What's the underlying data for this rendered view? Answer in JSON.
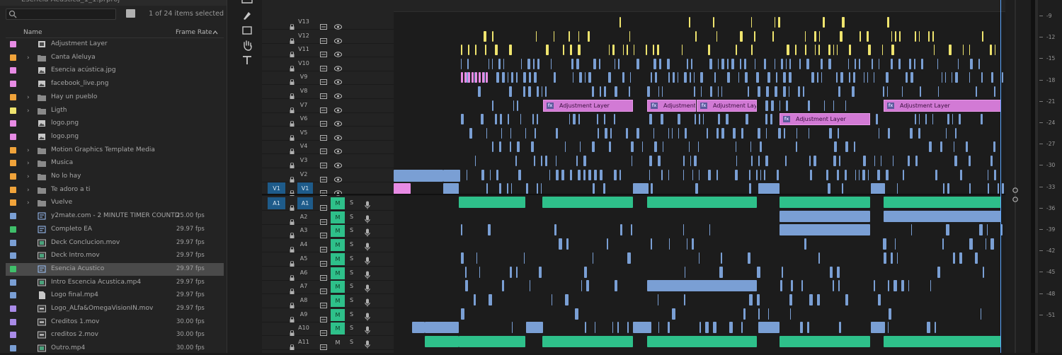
{
  "project": {
    "title": "Esencia Acústica_1_1.prproj",
    "selection_count": "1 of 24 items selected",
    "columns": {
      "name": "Name",
      "frame_rate": "Frame Rate"
    },
    "items": [
      {
        "name": "Adjustment Layer",
        "fps": "",
        "color": "#e78be4",
        "kind": "adjustment",
        "folder": false
      },
      {
        "name": "Canta Aleluya",
        "fps": "",
        "color": "#f0a33a",
        "kind": "folder",
        "folder": true
      },
      {
        "name": "Esencia acústica.jpg",
        "fps": "",
        "color": "#e78be4",
        "kind": "image",
        "folder": false
      },
      {
        "name": "facebook_live.png",
        "fps": "",
        "color": "#e78be4",
        "kind": "image",
        "folder": false
      },
      {
        "name": "Hay un pueblo",
        "fps": "",
        "color": "#f0a33a",
        "kind": "folder",
        "folder": true
      },
      {
        "name": "Ligth",
        "fps": "",
        "color": "#efe46e",
        "kind": "folder",
        "folder": true
      },
      {
        "name": "logo.png",
        "fps": "",
        "color": "#e78be4",
        "kind": "image",
        "folder": false
      },
      {
        "name": "logo.png",
        "fps": "",
        "color": "#e78be4",
        "kind": "image",
        "folder": false
      },
      {
        "name": "Motion Graphics Template Media",
        "fps": "",
        "color": "#f0a33a",
        "kind": "folder",
        "folder": true
      },
      {
        "name": "Musica",
        "fps": "",
        "color": "#f0a33a",
        "kind": "folder",
        "folder": true
      },
      {
        "name": "No lo hay",
        "fps": "",
        "color": "#f0a33a",
        "kind": "folder",
        "folder": true
      },
      {
        "name": "Te adoro a ti",
        "fps": "",
        "color": "#f0a33a",
        "kind": "folder",
        "folder": true
      },
      {
        "name": "Vuelve",
        "fps": "",
        "color": "#f0a33a",
        "kind": "folder",
        "folder": true
      },
      {
        "name": "y2mate.com - 2 MINUTE TIMER  COUNTD",
        "fps": "25.00 fps",
        "color": "#7a9fd4",
        "kind": "sequence",
        "folder": false
      },
      {
        "name": "Completo EA",
        "fps": "29.97 fps",
        "color": "#3fbf6a",
        "kind": "sequence",
        "folder": false
      },
      {
        "name": "Deck Conclucion.mov",
        "fps": "29.97 fps",
        "color": "#7a9fd4",
        "kind": "video",
        "folder": false
      },
      {
        "name": "Deck Intro.mov",
        "fps": "29.97 fps",
        "color": "#7a9fd4",
        "kind": "video",
        "folder": false
      },
      {
        "name": "Esencia Acustico",
        "fps": "29.97 fps",
        "color": "#3fbf6a",
        "kind": "sequence",
        "folder": false,
        "selected": true
      },
      {
        "name": "Intro Escencia Acustica.mp4",
        "fps": "29.97 fps",
        "color": "#7a9fd4",
        "kind": "video",
        "folder": false
      },
      {
        "name": "Logo final.mp4",
        "fps": "29.97 fps",
        "color": "#7a9fd4",
        "kind": "file",
        "folder": false
      },
      {
        "name": "Logo_ALfa&OmegaVisionIN.mov",
        "fps": "29.97 fps",
        "color": "#a98be8",
        "kind": "media",
        "folder": false
      },
      {
        "name": "Creditos 1.mov",
        "fps": "30.00 fps",
        "color": "#a98be8",
        "kind": "media",
        "folder": false
      },
      {
        "name": "creditos 2.mov",
        "fps": "30.00 fps",
        "color": "#a98be8",
        "kind": "media",
        "folder": false
      },
      {
        "name": "Outro.mp4",
        "fps": "30.00 fps",
        "color": "#7a9fd4",
        "kind": "video",
        "folder": false
      }
    ]
  },
  "video_tracks": [
    "V13",
    "V12",
    "V11",
    "V10",
    "V9",
    "V8",
    "V7",
    "V6",
    "V5",
    "V4",
    "V3",
    "V2",
    "V1"
  ],
  "audio_tracks": [
    "A1",
    "A2",
    "A3",
    "A4",
    "A5",
    "A6",
    "A7",
    "A8",
    "A9",
    "A10",
    "A11"
  ],
  "source_patch": {
    "video": "V1",
    "audio": "A1"
  },
  "buttons": {
    "mute": "M",
    "solo": "S"
  },
  "adjustment_clips": [
    {
      "track": "V7",
      "label": "Adjustment Layer"
    },
    {
      "track": "V7",
      "label": "Adjustment L"
    },
    {
      "track": "V7",
      "label": "Adjustment Layer"
    },
    {
      "track": "V6",
      "label": "Adjustment Layer"
    },
    {
      "track": "V7",
      "label": "Adjustment Layer"
    }
  ],
  "fx_badge": "fx",
  "meter_ticks": [
    "-9",
    "-12",
    "-15",
    "-18",
    "-21",
    "-24",
    "-27",
    "-30",
    "-33",
    "-36",
    "-39",
    "-42",
    "-45",
    "-48",
    "-51"
  ],
  "colors": {
    "video_clip": "#7a9fd4",
    "audio_clip": "#2ec08a",
    "adjustment": "#d27ad5",
    "title_clip": "#efe46e",
    "patch": "#1e5b8a"
  }
}
